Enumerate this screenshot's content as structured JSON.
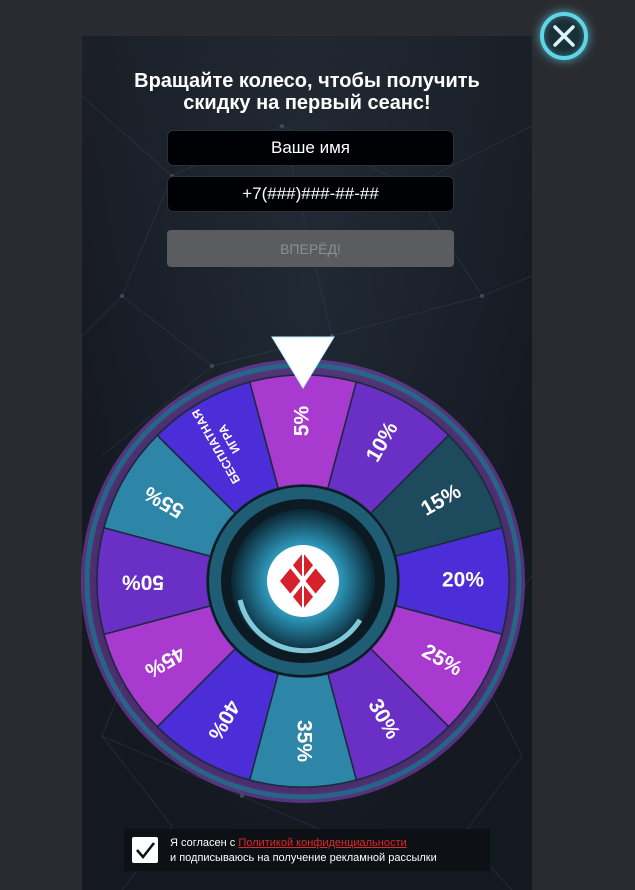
{
  "colors": {
    "panel_bg": "#171c24",
    "accent": "#5fd6e6",
    "field_bg": "#000105",
    "button_bg": "#5b5c5f",
    "link": "#e02828",
    "segment_pink": "#a83ad0",
    "segment_violet": "#6a2fc4",
    "segment_indigo": "#4b2ed8",
    "segment_dark_teal": "#1d4a5c",
    "segment_teal": "#2d86a8",
    "logo_red": "#d6202a"
  },
  "title": {
    "line1": "Вращайте колесо, чтобы получить",
    "line2": "скидку на первый сеанс!"
  },
  "form": {
    "name_placeholder": "Ваше имя",
    "phone_placeholder": "+7(###)###-##-##",
    "submit_label": "ВПЕРЁД!"
  },
  "wheel": {
    "segments": [
      {
        "label": "5%",
        "color": "#a83ad0"
      },
      {
        "label": "10%",
        "color": "#6a2fc4"
      },
      {
        "label": "15%",
        "color": "#1d4a5c"
      },
      {
        "label": "20%",
        "color": "#4b2ed8"
      },
      {
        "label": "25%",
        "color": "#a83ad0"
      },
      {
        "label": "30%",
        "color": "#6a2fc4"
      },
      {
        "label": "35%",
        "color": "#2d86a8"
      },
      {
        "label": "40%",
        "color": "#4b2ed8"
      },
      {
        "label": "45%",
        "color": "#a83ad0"
      },
      {
        "label": "50%",
        "color": "#6a2fc4"
      },
      {
        "label": "55%",
        "color": "#2d86a8"
      },
      {
        "label": "БЕСПЛАТНАЯ ИГРА",
        "color": "#4b2ed8"
      }
    ],
    "pointer_icon": "triangle-down",
    "center_logo": "red-diamond-logo"
  },
  "consent": {
    "checked": true,
    "text_before": "Я согласен с ",
    "link_text": "Политикой конфиденциальности",
    "line2": "и подписываюсь на получение рекламной рассылки"
  },
  "close_icon": "close-x"
}
